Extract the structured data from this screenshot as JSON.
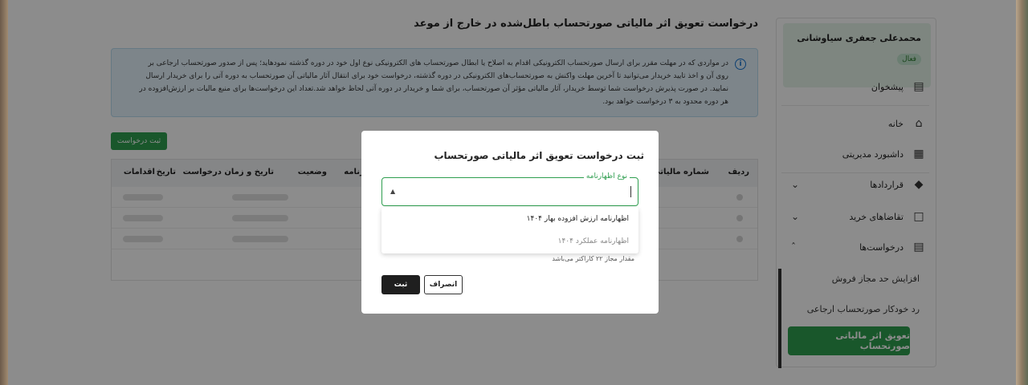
{
  "page": {
    "title": "درخواست تعویق اثر مالیاتی صورتحساب باطل‌شده در خارج از موعد",
    "notice": "در مواردی که در مهلت مقرر برای ارسال صورتحساب الکترونیکی اقدام به اصلاح یا ابطال صورتحساب های الکترونیکی نوع اول خود در دوره گذشته نمودهاید؛ پس از صدور صورتحساب ارجاعی بر روی آن و اخذ تایید خریدار می‌توانید تا آخرین مهلت واکنش به صورتحساب‌های الکترونیکی در دوره گذشته، درخواست خود برای انتقال آثار مالیاتی آن صورتحساب به دوره آتی را برای خریدار ارسال نمایید. در صورت پذیرش درخواست شما توسط خریدار، آثار مالیاتی مؤثر آن صورتحساب، برای شما و خریدار در دوره آتی لحاظ خواهد شد.تعداد این درخواست‌ها برای منبع مالیات بر ارزش‌افزوده در هر دوره محدود به ۳ درخواست خواهد بود.",
    "submit_request_label": "ثبت درخواست"
  },
  "sidebar": {
    "user_name": "محمدعلی جعفری سیاوشانی",
    "user_status": "فعال",
    "items": [
      {
        "label": "پیشخوان",
        "icon": "dashboard-icon"
      },
      {
        "label": "خانه",
        "icon": "home-icon"
      },
      {
        "label": "داشبورد مدیریتی",
        "icon": "grid-icon"
      },
      {
        "label": "قراردادها",
        "icon": "tag-icon"
      },
      {
        "label": "تقاضاهای خرید",
        "icon": "clipboard-icon"
      },
      {
        "label": "درخواست‌ها",
        "icon": "chat-icon"
      }
    ],
    "sub_items": [
      "افزایش حد مجاز فروش",
      "رد خودکار صورتحساب ارجاعی",
      "تعویق اثر مالیاتی صورتحساب"
    ]
  },
  "table": {
    "headers": [
      "ردیف",
      "شماره مالیاتی",
      "اظهارنامه",
      "وضعیت",
      "تاریخ و زمان درخواست",
      "تاریخ",
      "اقدامات"
    ]
  },
  "modal": {
    "title": "ثبت درخواست تعویق اثر مالیاتی صورتحساب",
    "field_label": "نوع اظهارنامه",
    "options": [
      "اظهارنامه ارزش افزوده بهار ۱۴۰۴",
      "اظهارنامه عملکرد ۱۴۰۴"
    ],
    "helper": "مقدار مجاز ۲۲ کاراکتر می‌باشد",
    "ok_label": "ثبت",
    "cancel_label": "انصراف"
  }
}
